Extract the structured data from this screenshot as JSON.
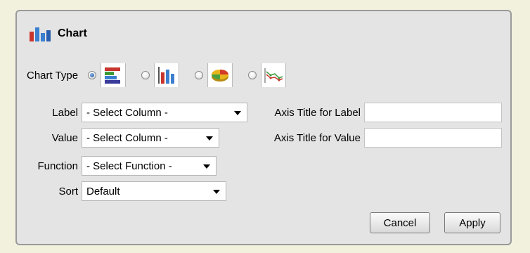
{
  "dialog": {
    "title": "Chart",
    "title_icon": "bar-chart-icon"
  },
  "chart_type": {
    "label": "Chart Type",
    "options": [
      {
        "name": "horizontal-bar",
        "icon": "horizontal-bar-chart-icon",
        "checked": true
      },
      {
        "name": "vertical-bar",
        "icon": "vertical-bar-chart-icon",
        "checked": false
      },
      {
        "name": "pie",
        "icon": "pie-chart-icon",
        "checked": false
      },
      {
        "name": "line",
        "icon": "line-chart-icon",
        "checked": false
      }
    ]
  },
  "fields": {
    "label": {
      "label": "Label",
      "value": "- Select Column -"
    },
    "value": {
      "label": "Value",
      "value": "- Select Column -"
    },
    "function": {
      "label": "Function",
      "value": "- Select Function -"
    },
    "sort": {
      "label": "Sort",
      "value": "Default"
    },
    "axis_title_label": {
      "label": "Axis Title for Label",
      "value": ""
    },
    "axis_title_value": {
      "label": "Axis Title for Value",
      "value": ""
    }
  },
  "buttons": {
    "cancel": "Cancel",
    "apply": "Apply"
  },
  "colors": {
    "page_background": "#f2f1de",
    "dialog_background": "#e4e4e4",
    "dialog_border": "#9a9a9a"
  }
}
